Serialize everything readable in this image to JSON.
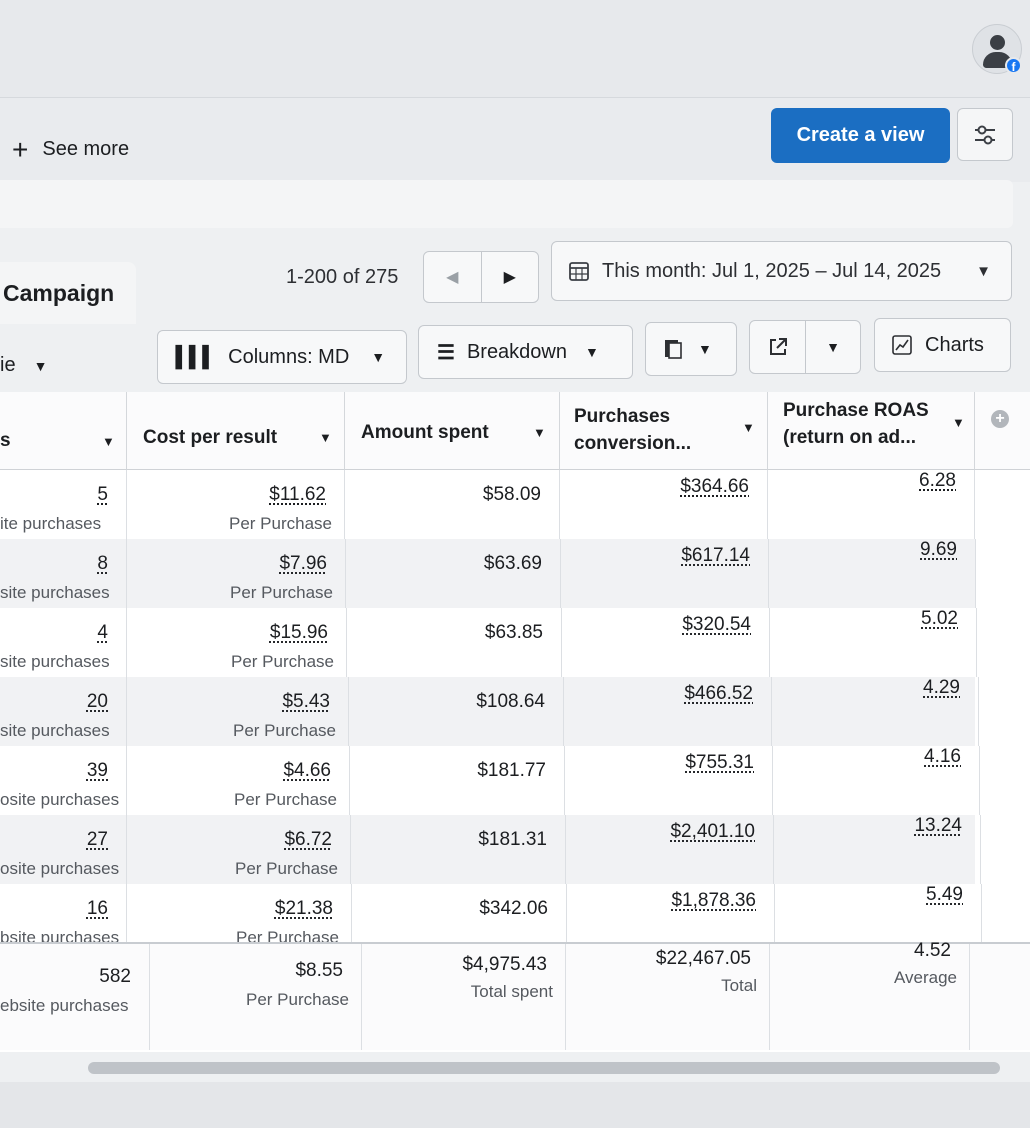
{
  "header": {
    "see_more": "See more",
    "create_view": "Create a view"
  },
  "tab": {
    "campaign": "Campaign"
  },
  "pager": {
    "text": "1-200 of 275"
  },
  "date_range": {
    "label": "This month: Jul 1, 2025 – Jul 14, 2025"
  },
  "toolbar": {
    "partial_label": "ie",
    "columns": "Columns: MD",
    "breakdown": "Breakdown",
    "charts": "Charts"
  },
  "table": {
    "columns": [
      {
        "label": "s"
      },
      {
        "label": "Cost per result"
      },
      {
        "label": "Amount spent"
      },
      {
        "label_line1": "Purchases",
        "label_line2": "conversion..."
      },
      {
        "label_line1": "Purchase ROAS",
        "label_line2": "(return on ad..."
      }
    ],
    "rows": [
      {
        "results": "5",
        "results_sub": "ite purchases",
        "cost": "$11.62",
        "cost_sub": "Per Purchase",
        "spent": "$58.09",
        "conv": "$364.66",
        "roas": "6.28"
      },
      {
        "results": "8",
        "results_sub": "site purchases",
        "cost": "$7.96",
        "cost_sub": "Per Purchase",
        "spent": "$63.69",
        "conv": "$617.14",
        "roas": "9.69"
      },
      {
        "results": "4",
        "results_sub": "site purchases",
        "cost": "$15.96",
        "cost_sub": "Per Purchase",
        "spent": "$63.85",
        "conv": "$320.54",
        "roas": "5.02"
      },
      {
        "results": "20",
        "results_sub": "site purchases",
        "cost": "$5.43",
        "cost_sub": "Per Purchase",
        "spent": "$108.64",
        "conv": "$466.52",
        "roas": "4.29"
      },
      {
        "results": "39",
        "results_sub": "osite purchases",
        "cost": "$4.66",
        "cost_sub": "Per Purchase",
        "spent": "$181.77",
        "conv": "$755.31",
        "roas": "4.16"
      },
      {
        "results": "27",
        "results_sub": "osite purchases",
        "cost": "$6.72",
        "cost_sub": "Per Purchase",
        "spent": "$181.31",
        "conv": "$2,401.10",
        "roas": "13.24"
      },
      {
        "results": "16",
        "results_sub": "bsite purchases",
        "cost": "$21.38",
        "cost_sub": "Per Purchase",
        "spent": "$342.06",
        "conv": "$1,878.36",
        "roas": "5.49"
      }
    ],
    "totals": {
      "results": "582",
      "results_sub": "ebsite purchases",
      "cost": "$8.55",
      "cost_sub": "Per Purchase",
      "spent": "$4,975.43",
      "spent_sub": "Total spent",
      "conv": "$22,467.05",
      "conv_sub": "Total",
      "roas": "4.52",
      "roas_sub": "Average"
    }
  },
  "colors": {
    "primary": "#1b6ec2",
    "facebook": "#1877f2"
  }
}
